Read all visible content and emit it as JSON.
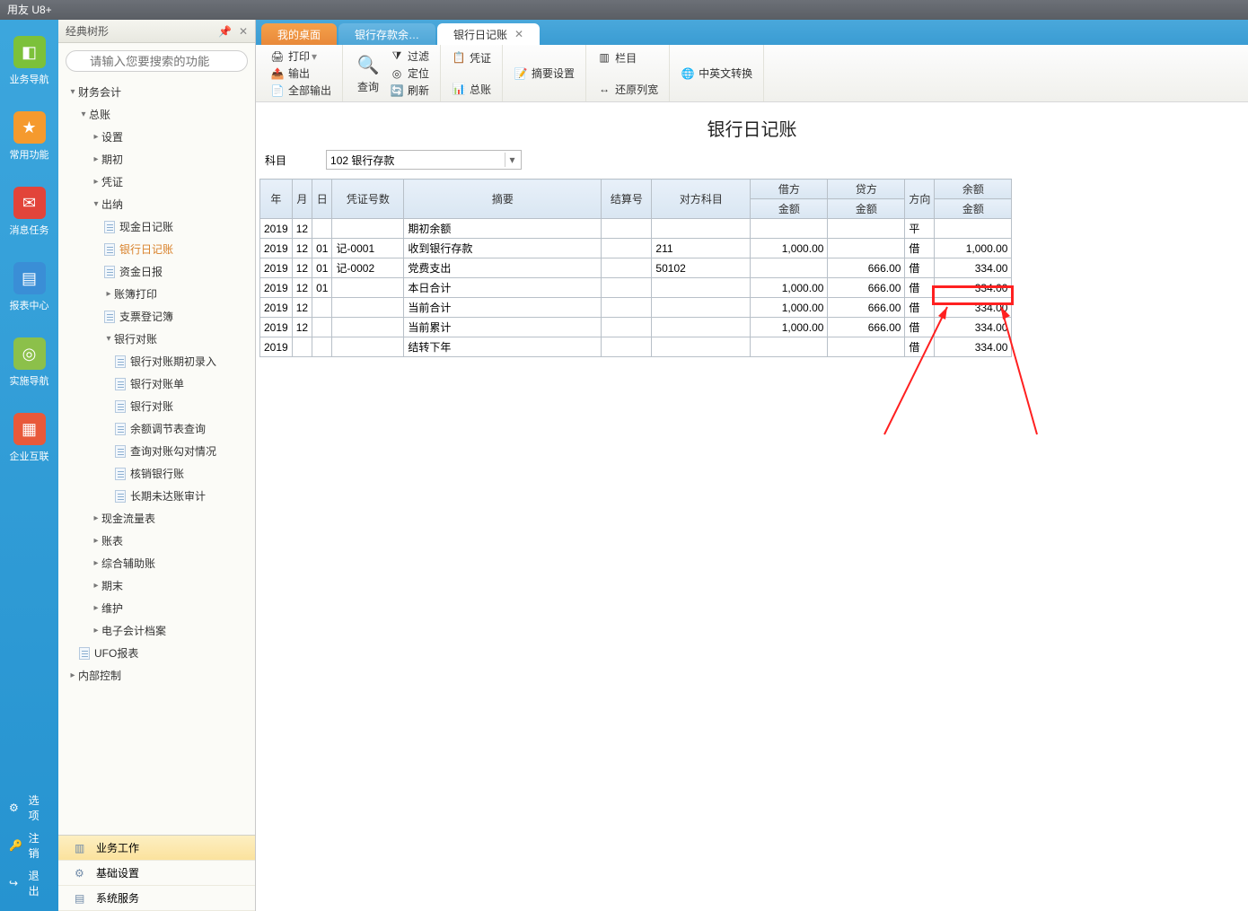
{
  "app_title": "用友 U8+",
  "leftnav": [
    {
      "label": "业务导航",
      "bg": "#7cc13a"
    },
    {
      "label": "常用功能",
      "bg": "#f59a2e"
    },
    {
      "label": "消息任务",
      "bg": "#e2443a"
    },
    {
      "label": "报表中心",
      "bg": "#3a8ed6"
    },
    {
      "label": "实施导航",
      "bg": "#8cc04a"
    },
    {
      "label": "企业互联",
      "bg": "#e8593a"
    }
  ],
  "leftbottom": [
    {
      "label": "选项",
      "icon": "⚙"
    },
    {
      "label": "注销",
      "icon": "🔑"
    },
    {
      "label": "退出",
      "icon": "↪"
    }
  ],
  "treetitle": "经典树形",
  "search_placeholder": "请输入您要搜索的功能",
  "tree": {
    "root": "财务会计",
    "n1": "总账",
    "n1a": "设置",
    "n1b": "期初",
    "n1c": "凭证",
    "n1d": "出纳",
    "leaf_xjrjz": "现金日记账",
    "leaf_yhrjz": "银行日记账",
    "leaf_zjrb": "资金日报",
    "leaf_zbdy": "账簿打印",
    "leaf_zpdjb": "支票登记簿",
    "leaf_yhdz": "银行对账",
    "leaf_yhdzqclr": "银行对账期初录入",
    "leaf_yhdzd": "银行对账单",
    "leaf_yhdz2": "银行对账",
    "leaf_yetjbcx": "余额调节表查询",
    "leaf_cxdzgdqk": "查询对账勾对情况",
    "leaf_hxyhz": "核销银行账",
    "leaf_cqwdzsj": "长期未达账审计",
    "leaf_xjllb": "现金流量表",
    "leaf_zb": "账表",
    "leaf_zhfzz": "综合辅助账",
    "leaf_qm": "期末",
    "leaf_wh": "维护",
    "leaf_dzkjda": "电子会计档案",
    "leaf_ufo": "UFO报表",
    "leaf_nbkz": "内部控制"
  },
  "bottomtabs": [
    {
      "label": "业务工作"
    },
    {
      "label": "基础设置"
    },
    {
      "label": "系统服务"
    }
  ],
  "tabs": [
    {
      "label": "我的桌面"
    },
    {
      "label": "银行存款余…"
    },
    {
      "label": "银行日记账"
    }
  ],
  "toolbar": {
    "print": "打印",
    "export": "输出",
    "exportall": "全部输出",
    "query": "查询",
    "filter": "过滤",
    "locate": "定位",
    "refresh": "刷新",
    "voucher": "凭证",
    "ledger": "总账",
    "summaryset": "摘要设置",
    "columns": "栏目",
    "restorewidth": "还原列宽",
    "zhongying": "中英文转换"
  },
  "page_heading": "银行日记账",
  "subject_label": "科目",
  "subject_value": "102 银行存款",
  "grid": {
    "headers": {
      "year": "年",
      "month": "月",
      "day": "日",
      "voucher": "凭证号数",
      "summary": "摘要",
      "settleno": "结算号",
      "oppacct": "对方科目",
      "debit": "借方",
      "credit": "贷方",
      "amount": "金额",
      "dir": "方向",
      "balance": "余额"
    },
    "rows": [
      {
        "year": "2019",
        "month": "12",
        "day": "",
        "voucher": "",
        "summary": "期初余额",
        "settleno": "",
        "oppacct": "",
        "debit": "",
        "credit": "",
        "dir": "平",
        "balance": ""
      },
      {
        "year": "2019",
        "month": "12",
        "day": "01",
        "voucher": "记-0001",
        "summary": "收到银行存款",
        "settleno": "",
        "oppacct": "211",
        "debit": "1,000.00",
        "credit": "",
        "dir": "借",
        "balance": "1,000.00"
      },
      {
        "year": "2019",
        "month": "12",
        "day": "01",
        "voucher": "记-0002",
        "summary": "党费支出",
        "settleno": "",
        "oppacct": "50102",
        "debit": "",
        "credit": "666.00",
        "dir": "借",
        "balance": "334.00"
      },
      {
        "year": "2019",
        "month": "12",
        "day": "01",
        "voucher": "",
        "summary": "本日合计",
        "settleno": "",
        "oppacct": "",
        "debit": "1,000.00",
        "credit": "666.00",
        "dir": "借",
        "balance": "334.00"
      },
      {
        "year": "2019",
        "month": "12",
        "day": "",
        "voucher": "",
        "summary": "当前合计",
        "settleno": "",
        "oppacct": "",
        "debit": "1,000.00",
        "credit": "666.00",
        "dir": "借",
        "balance": "334.00"
      },
      {
        "year": "2019",
        "month": "12",
        "day": "",
        "voucher": "",
        "summary": "当前累计",
        "settleno": "",
        "oppacct": "",
        "debit": "1,000.00",
        "credit": "666.00",
        "dir": "借",
        "balance": "334.00"
      },
      {
        "year": "2019",
        "month": "",
        "day": "",
        "voucher": "",
        "summary": "结转下年",
        "settleno": "",
        "oppacct": "",
        "debit": "",
        "credit": "",
        "dir": "借",
        "balance": "334.00"
      }
    ]
  }
}
